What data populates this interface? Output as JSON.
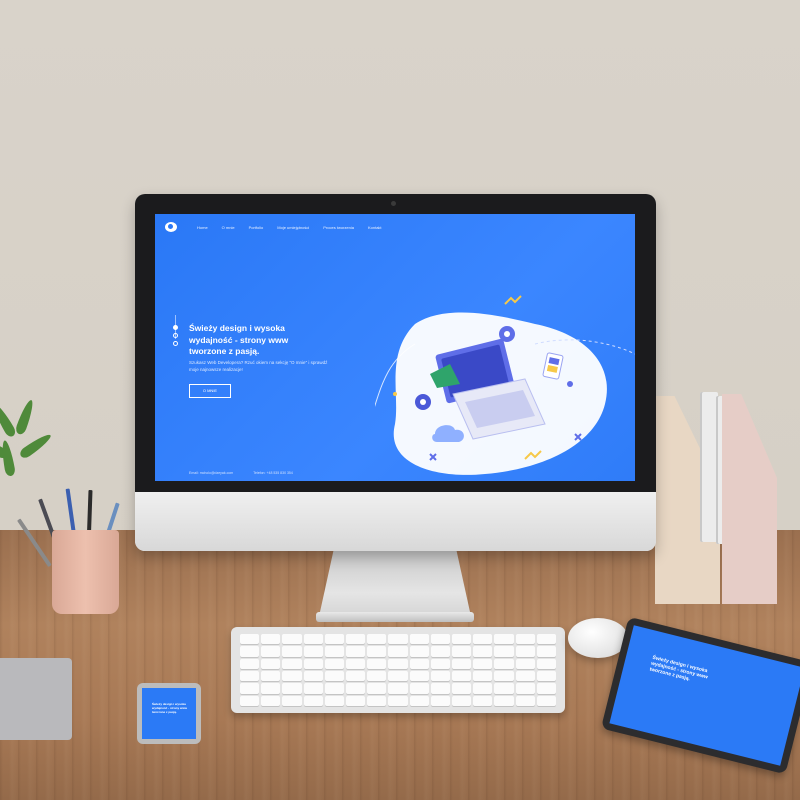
{
  "screen": {
    "nav": {
      "items": [
        "Home",
        "O mnie",
        "Portfolio",
        "Moje umiejętności",
        "Proces tworzenia",
        "Kontakt"
      ]
    },
    "hero": {
      "title_lines": [
        "Świeży design i wysoka",
        "wydajność - strony www",
        "tworzone z pasją."
      ],
      "text": "Szukasz Web Developera? Rzuć okiem na sekcję \"O mnie\" i sprawdź moje najnowsze realizacje!",
      "button": "O MNIE"
    },
    "footer": {
      "email": "Email: mcholo@dzeyak.com",
      "phone": "Telefon: +48 535 830 354"
    },
    "accent": "#2a78f6"
  },
  "tablet": {
    "title": "Świeży design i wysoka wydajność - strony www tworzone z pasją."
  },
  "phone": {
    "title": "Świeży design i wysoka wydajność - strony www tworzone z pasją."
  }
}
